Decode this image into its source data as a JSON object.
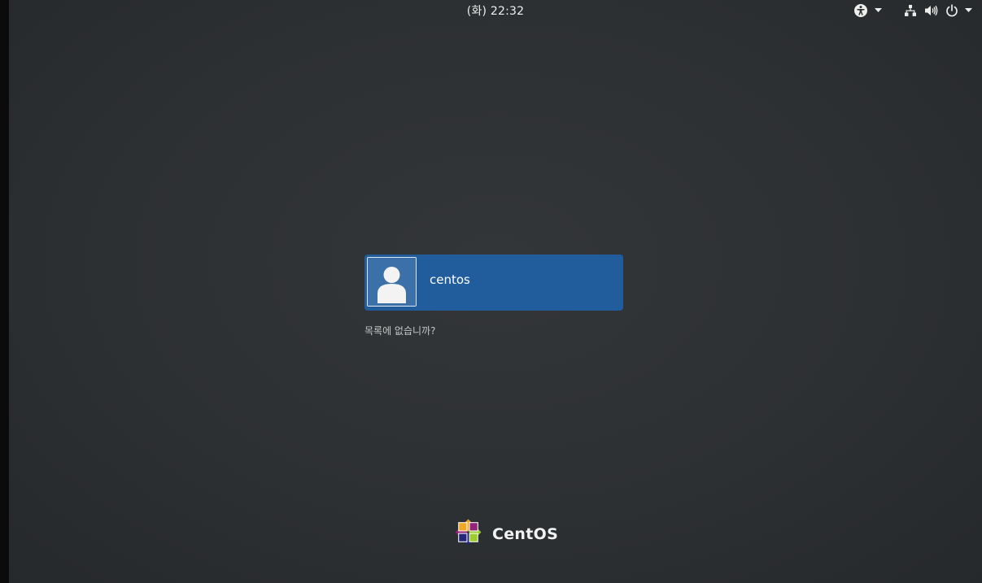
{
  "topbar": {
    "clock": "(화) 22:32"
  },
  "login": {
    "username": "centos",
    "not_listed": "목록에 없습니까?"
  },
  "branding": {
    "logo_text": "CentOS"
  },
  "colors": {
    "background": "#2d3033",
    "user_card": "#215d9c",
    "text": "#eeeeec"
  },
  "icons": {
    "accessibility": "accessibility-icon",
    "network": "network-icon",
    "volume": "volume-icon",
    "power": "power-icon",
    "avatar": "user-avatar-icon",
    "logo": "centos-logo-icon"
  }
}
